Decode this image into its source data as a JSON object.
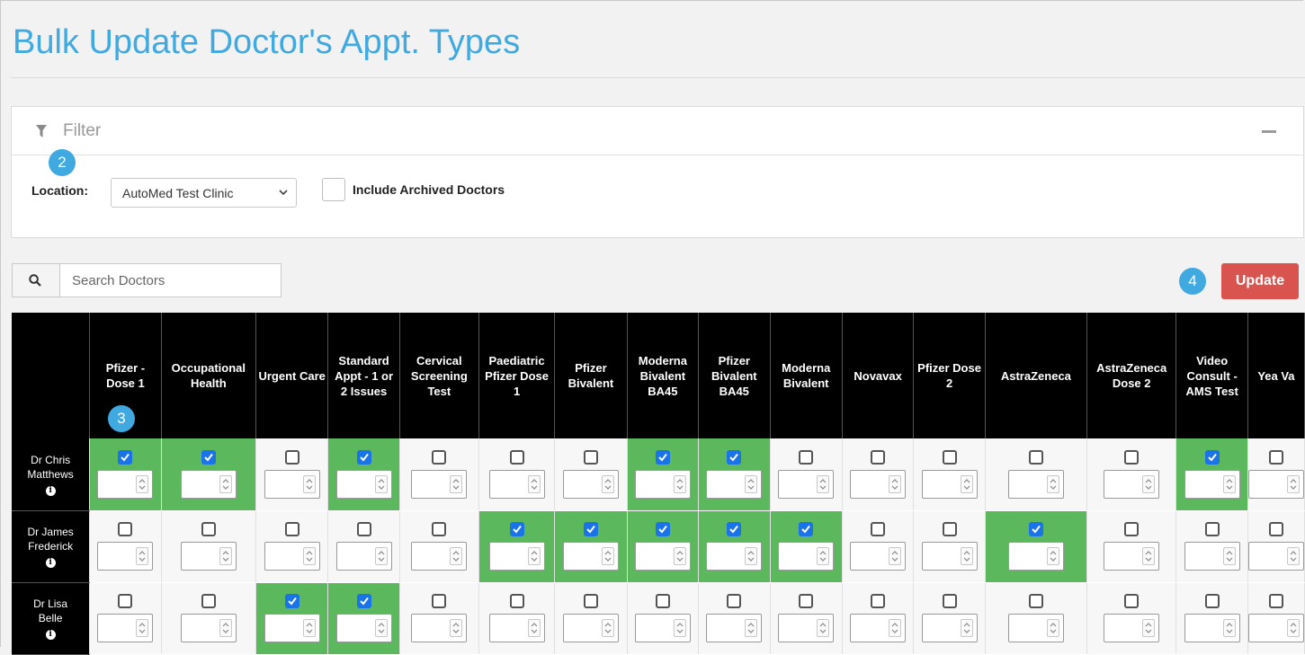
{
  "page": {
    "title": "Bulk Update Doctor's Appt. Types"
  },
  "filter": {
    "label": "Filter",
    "location_label": "Location:",
    "location_value": "AutoMed Test Clinic",
    "archived_label": "Include Archived Doctors"
  },
  "callouts": {
    "c2": "2",
    "c3": "3",
    "c4": "4"
  },
  "search": {
    "placeholder": "Search Doctors"
  },
  "toolbar": {
    "update_label": "Update"
  },
  "colors": {
    "accent": "#3fa9e0",
    "checked_cell": "#5cb85c",
    "update_button": "#d9534f",
    "header_bg": "#000000"
  },
  "columns": [
    "Pfizer - Dose 1",
    "Occupational Health",
    "Urgent Care",
    "Standard Appt - 1 or 2 Issues",
    "Cervical Screening Test",
    "Paediatric Pfizer Dose 1",
    "Pfizer Bivalent",
    "Moderna Bivalent BA45",
    "Pfizer Bivalent BA45",
    "Moderna Bivalent",
    "Novavax",
    "Pfizer Dose 2",
    "AstraZeneca",
    "AstraZeneca Dose 2",
    "Video Consult - AMS Test",
    "Yea Va"
  ],
  "doctors": [
    {
      "name_line1": "Dr Chris",
      "name_line2": "Matthews",
      "checked": [
        true,
        true,
        false,
        true,
        false,
        false,
        false,
        true,
        true,
        false,
        false,
        false,
        false,
        false,
        true,
        false
      ]
    },
    {
      "name_line1": "Dr James",
      "name_line2": "Frederick",
      "checked": [
        false,
        false,
        false,
        false,
        false,
        true,
        true,
        true,
        true,
        true,
        false,
        false,
        true,
        false,
        false,
        false
      ]
    },
    {
      "name_line1": "Dr Lisa",
      "name_line2": "Belle",
      "checked": [
        false,
        false,
        true,
        true,
        false,
        false,
        false,
        false,
        false,
        false,
        false,
        false,
        false,
        false,
        false,
        false
      ]
    }
  ]
}
